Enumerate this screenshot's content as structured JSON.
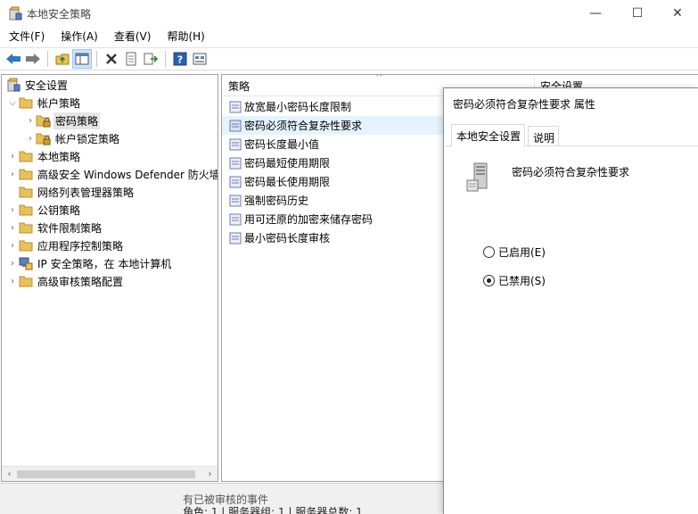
{
  "window": {
    "title": "本地安全策略",
    "controls": {
      "minimize": "—",
      "maximize": "☐",
      "close": "✕"
    }
  },
  "menu": [
    "文件(F)",
    "操作(A)",
    "查看(V)",
    "帮助(H)"
  ],
  "toolbar": {
    "buttons": [
      "back-arrow-icon",
      "forward-arrow-icon",
      "up-folder-icon",
      "show-hide-tree-icon",
      "delete-icon",
      "properties-icon",
      "export-list-icon",
      "help-icon",
      "view-icon"
    ]
  },
  "tree": {
    "items": [
      {
        "label": "安全设置",
        "icon": "security-settings-icon"
      },
      {
        "label": "帐户策略",
        "icon": "folder-icon"
      },
      {
        "label": "密码策略",
        "icon": "folder-lock-icon"
      },
      {
        "label": "帐户锁定策略",
        "icon": "folder-lock-icon"
      },
      {
        "label": "本地策略",
        "icon": "folder-icon"
      },
      {
        "label": "高级安全 Windows Defender 防火墙",
        "icon": "folder-icon"
      },
      {
        "label": "网络列表管理器策略",
        "icon": "folder-icon"
      },
      {
        "label": "公钥策略",
        "icon": "folder-icon"
      },
      {
        "label": "软件限制策略",
        "icon": "folder-icon"
      },
      {
        "label": "应用程序控制策略",
        "icon": "folder-icon"
      },
      {
        "label": "IP 安全策略，在 本地计算机",
        "icon": "ip-security-icon"
      },
      {
        "label": "高级审核策略配置",
        "icon": "folder-icon"
      }
    ]
  },
  "list": {
    "columns": [
      "策略",
      "安全设置"
    ],
    "rows": [
      "放宽最小密码长度限制",
      "密码必须符合复杂性要求",
      "密码长度最小值",
      "密码最短使用期限",
      "密码最长使用期限",
      "强制密码历史",
      "用可还原的加密来储存密码",
      "最小密码长度审核"
    ]
  },
  "status": {
    "line1": "有已被审核的事件",
    "line2": "角色: 1 | 服务器组: 1 | 服务器总数: 1"
  },
  "dialog": {
    "title": "密码必须符合复杂性要求 属性",
    "tabs": [
      "本地安全设置",
      "说明"
    ],
    "policy_name": "密码必须符合复杂性要求",
    "options": [
      {
        "label": "已启用(E)",
        "checked": false
      },
      {
        "label": "已禁用(S)",
        "checked": true
      }
    ]
  },
  "colors": {
    "selection": "#e5f3ff",
    "tree_selected": "#e5e5e5",
    "folder": "#e8c15a"
  }
}
